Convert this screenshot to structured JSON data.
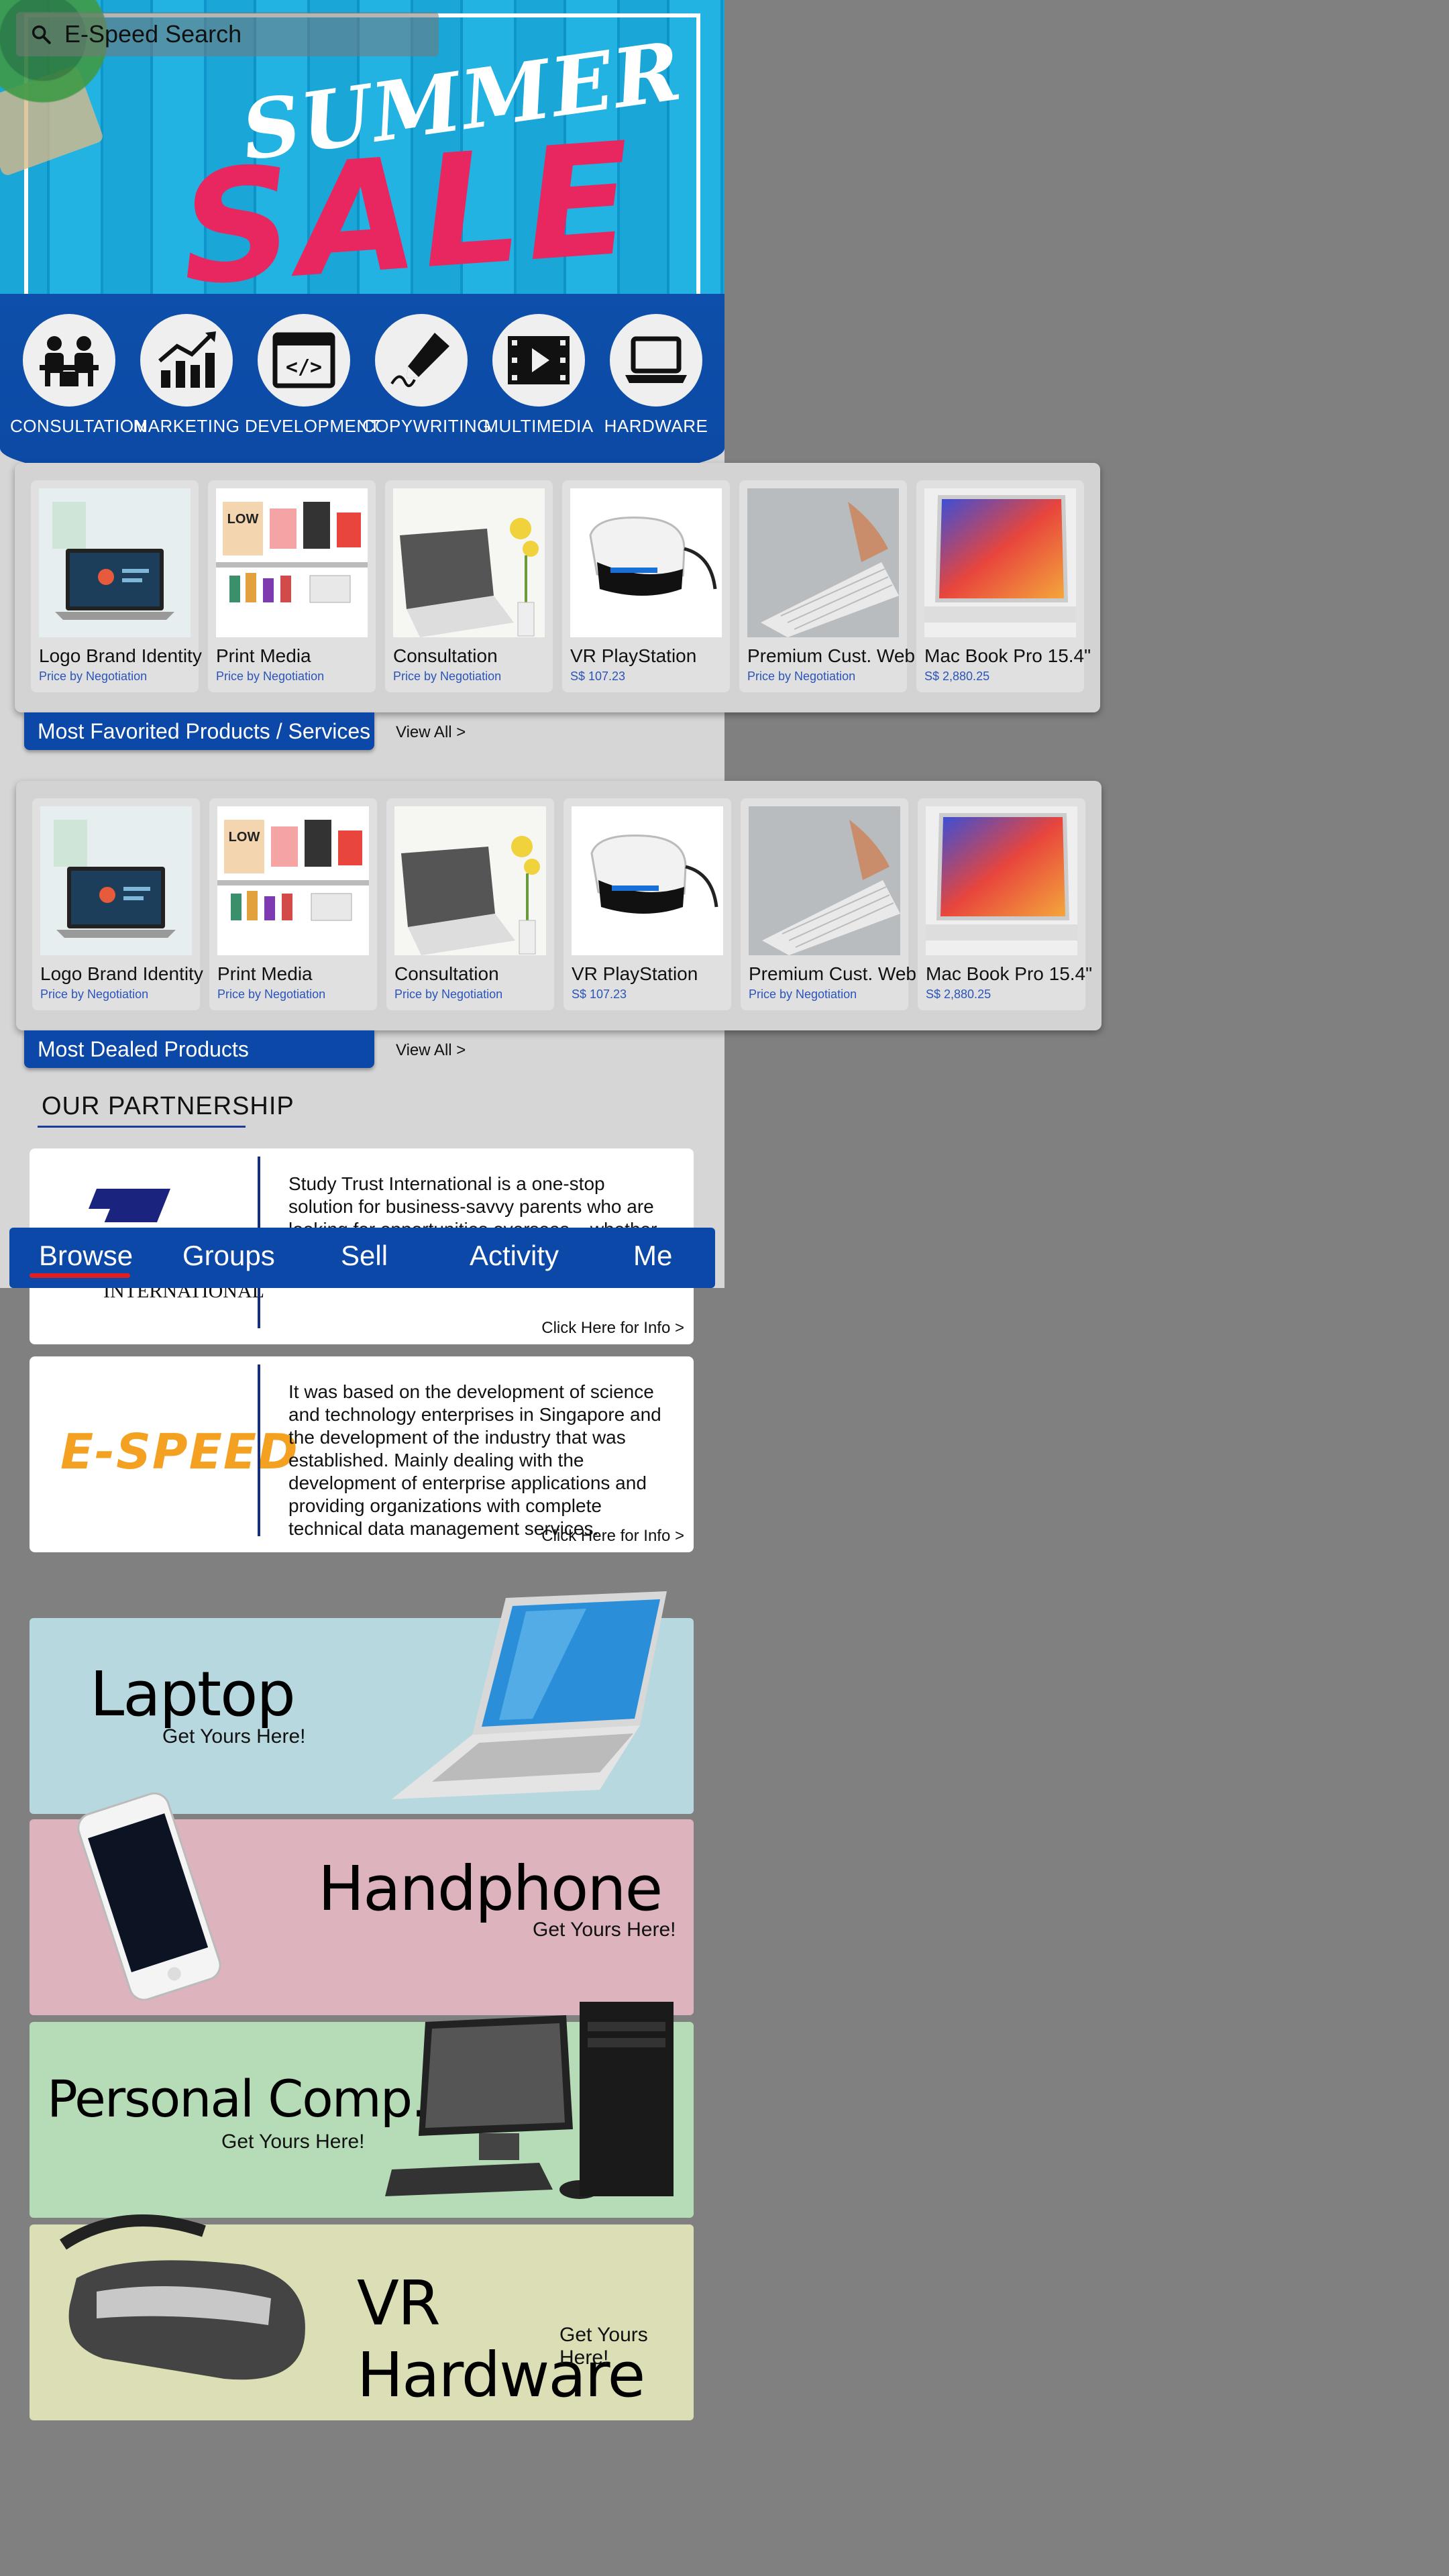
{
  "search": {
    "placeholder": "E-Speed Search"
  },
  "hero": {
    "line1": "SUMMER",
    "line2": "SALE"
  },
  "categories": [
    {
      "label": "CONSULTATION",
      "icon": "consultation-icon"
    },
    {
      "label": "MARKETING",
      "icon": "chart-growth-icon"
    },
    {
      "label": "DEVELOPMENT",
      "icon": "code-window-icon"
    },
    {
      "label": "COPYWRITING",
      "icon": "pen-icon"
    },
    {
      "label": "MULTIMEDIA",
      "icon": "film-play-icon"
    },
    {
      "label": "HARDWARE",
      "icon": "laptop-icon"
    }
  ],
  "favorited": {
    "title": "Most Favorited Products / Services",
    "view_all": "View All >",
    "products": [
      {
        "name": "Logo Brand Identity",
        "price": "Price by Negotiation"
      },
      {
        "name": "Print Media",
        "price": "Price by Negotiation"
      },
      {
        "name": "Consultation",
        "price": "Price by Negotiation"
      },
      {
        "name": "VR PlayStation",
        "price": "S$ 107.23"
      },
      {
        "name": "Premium Cust. Web",
        "price": "Price by Negotiation"
      },
      {
        "name": "Mac Book Pro 15.4\"",
        "price": "S$ 2,880.25"
      }
    ]
  },
  "dealed": {
    "title": "Most Dealed Products",
    "view_all": "View All >",
    "products": [
      {
        "name": "Logo Brand Identity",
        "price": "Price by Negotiation"
      },
      {
        "name": "Print Media",
        "price": "Price by Negotiation"
      },
      {
        "name": "Consultation",
        "price": "Price by Negotiation"
      },
      {
        "name": "VR PlayStation",
        "price": "S$ 107.23"
      },
      {
        "name": "Premium Cust. Web",
        "price": "Price by Negotiation"
      },
      {
        "name": "Mac Book Pro 15.4\"",
        "price": "S$ 2,880.25"
      }
    ]
  },
  "partnership": {
    "title": "OUR PARTNERSHIP",
    "partners": [
      {
        "logo_text": "INTERNATIONAL",
        "description": "Study Trust International is a one-stop solution for business-savvy parents who are looking for opportunities overseas – whether it be to send ... expand their investment portfolio.",
        "info": "Click Here for Info >"
      },
      {
        "logo_text": "E-SPEED",
        "description": "It was based on the development of science and technology enterprises in Singapore and the development of the industry that was established. Mainly dealing with the development of enterprise applications and providing organizations with complete technical data management services.",
        "info": "Click Here for Info >"
      }
    ]
  },
  "bottom_nav": [
    "Browse",
    "Groups",
    "Sell",
    "Activity",
    "Me"
  ],
  "promos": [
    {
      "title": "Laptop",
      "cta": "Get Yours Here!",
      "color": "#b8d8df"
    },
    {
      "title": "Handphone",
      "cta": "Get Yours Here!",
      "color": "#ddb3bd"
    },
    {
      "title": "Personal Comp.",
      "cta": "Get Yours Here!",
      "color": "#b5dcb6"
    },
    {
      "title": "VR Hardware",
      "cta": "Get Yours Here!",
      "color": "#dcdfb5"
    }
  ]
}
